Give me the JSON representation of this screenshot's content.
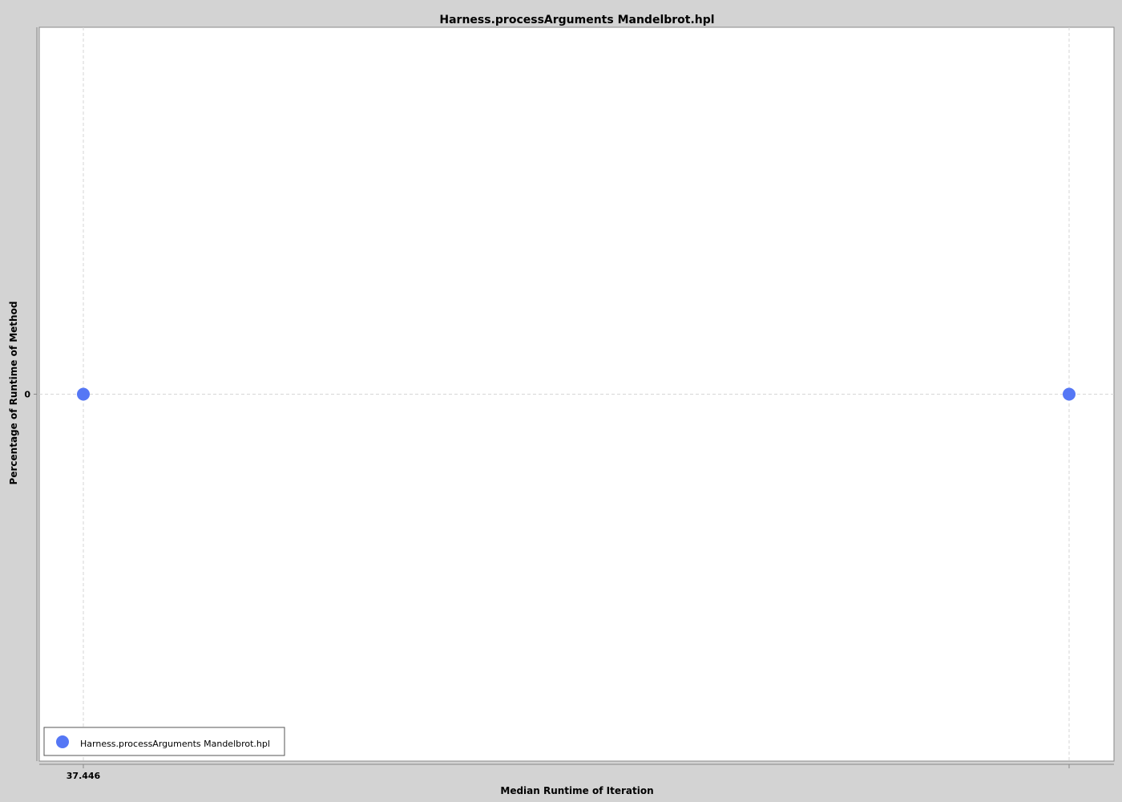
{
  "chart_data": {
    "type": "scatter",
    "title": "Harness.processArguments Mandelbrot.hpl",
    "xlabel": "Median Runtime of Iteration",
    "ylabel": "Percentage of Runtime of Method",
    "x_tick_labels": [
      "37.446"
    ],
    "y_tick_labels": [
      "0"
    ],
    "series": [
      {
        "name": "Harness.processArguments Mandelbrot.hpl",
        "color": "#5577f5",
        "points": [
          {
            "x": 37.446,
            "y": 0
          },
          {
            "x": 37.447,
            "y": 0
          }
        ]
      }
    ],
    "grid": true,
    "legend_position": "bottom-left"
  }
}
